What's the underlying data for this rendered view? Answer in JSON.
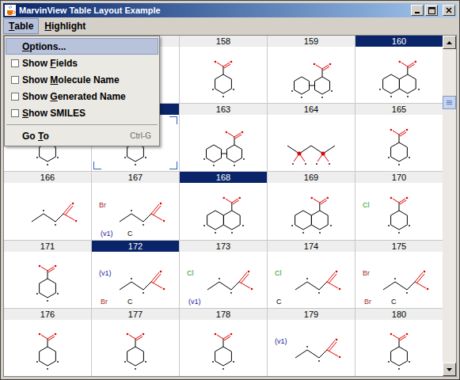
{
  "window": {
    "title": "MarvinView Table Layout Example"
  },
  "menubar": [
    {
      "label": "Table",
      "mnemonic": 0,
      "selected": true
    },
    {
      "label": "Highlight",
      "mnemonic": 0,
      "selected": false
    }
  ],
  "menu": {
    "items": [
      {
        "kind": "action",
        "label": "Options...",
        "mnemonic": 0,
        "shortcut": "",
        "checked": false,
        "selected": true
      },
      {
        "kind": "check",
        "label": "Show Fields",
        "mnemonic": 5,
        "shortcut": "",
        "checked": false,
        "selected": false
      },
      {
        "kind": "check",
        "label": "Show Molecule Name",
        "mnemonic": 5,
        "shortcut": "",
        "checked": false,
        "selected": false
      },
      {
        "kind": "check",
        "label": "Show Generated Name",
        "mnemonic": 5,
        "shortcut": "",
        "checked": false,
        "selected": false
      },
      {
        "kind": "check",
        "label": "Show SMILES",
        "mnemonic": 0,
        "shortcut": "",
        "checked": false,
        "selected": false
      },
      {
        "kind": "separator",
        "label": "",
        "mnemonic": -1,
        "shortcut": "",
        "checked": false,
        "selected": false
      },
      {
        "kind": "action",
        "label": "Go To",
        "mnemonic": 3,
        "shortcut": "Ctrl-G",
        "checked": false,
        "selected": false
      }
    ]
  },
  "table": {
    "rows": [
      [
        {
          "number": "",
          "selected": false,
          "focused": false,
          "structure": "ring",
          "atoms": []
        },
        {
          "number": "",
          "selected": false,
          "focused": false,
          "structure": "ring",
          "atoms": []
        },
        {
          "number": "158",
          "selected": false,
          "focused": false,
          "structure": "ring",
          "atoms": []
        },
        {
          "number": "159",
          "selected": false,
          "focused": false,
          "structure": "biaryl",
          "atoms": []
        },
        {
          "number": "160",
          "selected": true,
          "focused": false,
          "structure": "fused",
          "atoms": []
        }
      ],
      [
        {
          "number": "",
          "selected": false,
          "focused": false,
          "structure": "ring",
          "atoms": []
        },
        {
          "number": "",
          "selected": true,
          "focused": true,
          "structure": "ring",
          "atoms": []
        },
        {
          "number": "163",
          "selected": false,
          "focused": false,
          "structure": "biaryl",
          "atoms": []
        },
        {
          "number": "164",
          "selected": false,
          "focused": false,
          "structure": "sulfone",
          "atoms": []
        },
        {
          "number": "165",
          "selected": false,
          "focused": false,
          "structure": "ring",
          "atoms": []
        }
      ],
      [
        {
          "number": "166",
          "selected": false,
          "focused": false,
          "structure": "chain",
          "atoms": []
        },
        {
          "number": "167",
          "selected": false,
          "focused": false,
          "structure": "chain",
          "atoms": [
            {
              "text": "Br",
              "color": "#a52a2a"
            },
            {
              "text": "(v1)",
              "color": "#2020a0"
            },
            {
              "text": "C",
              "color": "#000000"
            }
          ]
        },
        {
          "number": "168",
          "selected": true,
          "focused": false,
          "structure": "fused",
          "atoms": []
        },
        {
          "number": "169",
          "selected": false,
          "focused": false,
          "structure": "fused",
          "atoms": []
        },
        {
          "number": "170",
          "selected": false,
          "focused": false,
          "structure": "ring",
          "atoms": [
            {
              "text": "Cl",
              "color": "#1fa01f"
            }
          ]
        }
      ],
      [
        {
          "number": "171",
          "selected": false,
          "focused": false,
          "structure": "ring",
          "atoms": []
        },
        {
          "number": "172",
          "selected": true,
          "focused": false,
          "structure": "chain",
          "atoms": [
            {
              "text": "(v1)",
              "color": "#2020a0"
            },
            {
              "text": "Br",
              "color": "#a52a2a"
            },
            {
              "text": "C",
              "color": "#000000"
            }
          ]
        },
        {
          "number": "173",
          "selected": false,
          "focused": false,
          "structure": "chain",
          "atoms": [
            {
              "text": "Cl",
              "color": "#1fa01f"
            },
            {
              "text": "(v1)",
              "color": "#2020a0"
            }
          ]
        },
        {
          "number": "174",
          "selected": false,
          "focused": false,
          "structure": "chain",
          "atoms": [
            {
              "text": "Cl",
              "color": "#1fa01f"
            },
            {
              "text": "C",
              "color": "#000000"
            }
          ]
        },
        {
          "number": "175",
          "selected": false,
          "focused": false,
          "structure": "chain",
          "atoms": [
            {
              "text": "Br",
              "color": "#a52a2a"
            },
            {
              "text": "Br",
              "color": "#a52a2a"
            },
            {
              "text": "C",
              "color": "#000000"
            }
          ]
        }
      ],
      [
        {
          "number": "176",
          "selected": false,
          "focused": false,
          "structure": "ring",
          "atoms": []
        },
        {
          "number": "177",
          "selected": false,
          "focused": false,
          "structure": "ring",
          "atoms": []
        },
        {
          "number": "178",
          "selected": false,
          "focused": false,
          "structure": "ring",
          "atoms": []
        },
        {
          "number": "179",
          "selected": false,
          "focused": false,
          "structure": "chain",
          "atoms": [
            {
              "text": "(v1)",
              "color": "#2020a0"
            }
          ]
        },
        {
          "number": "180",
          "selected": false,
          "focused": false,
          "structure": "ring",
          "atoms": []
        }
      ]
    ]
  },
  "scrollbar": {
    "level": 0.15
  }
}
